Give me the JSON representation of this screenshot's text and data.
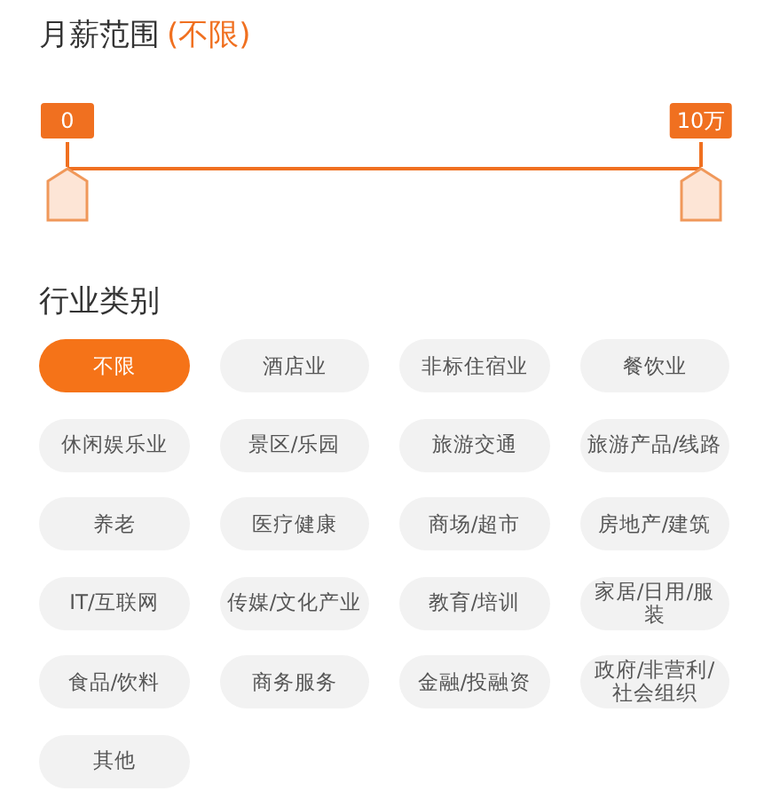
{
  "salary": {
    "title": "月薪范围",
    "value": "(不限)",
    "handles": [
      {
        "label": "0",
        "level": 0
      },
      {
        "label": "10万",
        "level": 1
      }
    ]
  },
  "industry": {
    "title": "行业类别",
    "options": [
      {
        "label": "不限",
        "selected": true
      },
      {
        "label": "酒店业",
        "selected": false
      },
      {
        "label": "非标住宿业",
        "selected": false
      },
      {
        "label": "餐饮业",
        "selected": false
      },
      {
        "label": "休闲娱乐业",
        "selected": false
      },
      {
        "label": "景区/乐园",
        "selected": false
      },
      {
        "label": "旅游交通",
        "selected": false
      },
      {
        "label": "旅游产品/线路",
        "selected": false
      },
      {
        "label": "养老",
        "selected": false
      },
      {
        "label": "医疗健康",
        "selected": false
      },
      {
        "label": "商场/超市",
        "selected": false
      },
      {
        "label": "房地产/建筑",
        "selected": false
      },
      {
        "label": "IT/互联网",
        "selected": false
      },
      {
        "label": "传媒/文化产业",
        "selected": false
      },
      {
        "label": "教育/培训",
        "selected": false
      },
      {
        "label": "家居/日用/服装",
        "selected": false
      },
      {
        "label": "食品/饮料",
        "selected": false
      },
      {
        "label": "商务服务",
        "selected": false
      },
      {
        "label": "金融/投融资",
        "selected": false
      },
      {
        "label": "政府/非营利/社会组织",
        "selected": false
      },
      {
        "label": "其他",
        "selected": false
      }
    ]
  }
}
